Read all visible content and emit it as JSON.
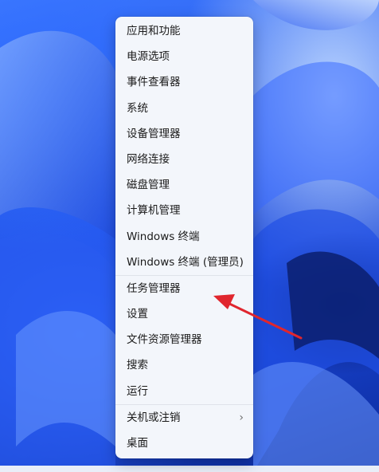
{
  "menu": {
    "groups": [
      [
        "应用和功能",
        "电源选项",
        "事件查看器",
        "系统",
        "设备管理器",
        "网络连接",
        "磁盘管理",
        "计算机管理",
        "Windows 终端",
        "Windows 终端 (管理员)"
      ],
      [
        "任务管理器",
        "设置",
        "文件资源管理器",
        "搜索",
        "运行"
      ],
      [
        "关机或注销",
        "桌面"
      ]
    ],
    "submenu_indicator": "›"
  },
  "colors": {
    "menu_background": "#f3f6fb",
    "arrow": "#e0262e",
    "wallpaper_blue": "#1f4fe4"
  },
  "icons": {
    "submenu": "chevron-right-icon",
    "annotation": "red-arrow-pointer"
  }
}
